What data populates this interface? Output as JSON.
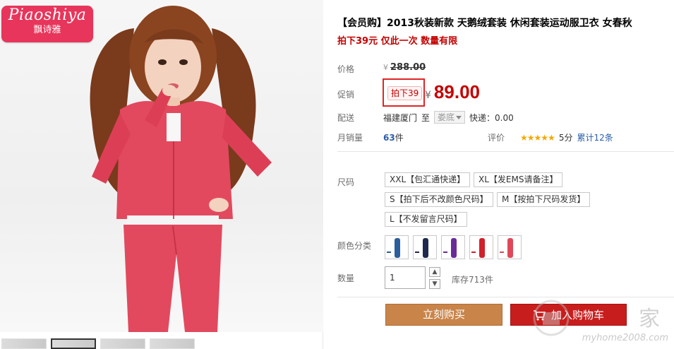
{
  "brand": {
    "name": "Piaoshiya",
    "name_cn": "飘诗雅"
  },
  "product": {
    "title": "【会员购】2013秋装新款 天鹅绒套装 休闲套装运动服卫衣 女春秋",
    "subtitle": "拍下39元 仅此一次 数量有限"
  },
  "price": {
    "label": "价格",
    "currency": "¥",
    "original": "288.00",
    "promo_label": "促销",
    "promo_tag": "拍下39",
    "promo_price": "89.00"
  },
  "shipping": {
    "label": "配送",
    "from": "福建厦门",
    "to_text": "至",
    "to_value": "娄底",
    "fee": "快递：0.00"
  },
  "sales": {
    "label": "月销量",
    "count": "63",
    "unit": "件",
    "rating_label": "评价",
    "stars": "★★★★★",
    "score": "5分",
    "reviews_link": "累计12条"
  },
  "size": {
    "label": "尺码",
    "options": [
      "XXL【包汇通快递】",
      "XL【发EMS请备注】",
      "S【拍下后不改颜色尺码】",
      "M【按拍下尺码发货】",
      "L【不发留言尺码】"
    ]
  },
  "color": {
    "label": "颜色分类",
    "swatches": [
      "#2b5e9c",
      "#1d2a4d",
      "#6b2a9a",
      "#d0202a",
      "#e0485a"
    ]
  },
  "quantity": {
    "label": "数量",
    "value": "1",
    "up": "▲",
    "down": "▼",
    "stock": "库存713件"
  },
  "actions": {
    "buy_now": "立刻购买",
    "add_cart": "加入购物车"
  },
  "watermark": {
    "text_cn": "家",
    "url": "myhome2008.com"
  }
}
